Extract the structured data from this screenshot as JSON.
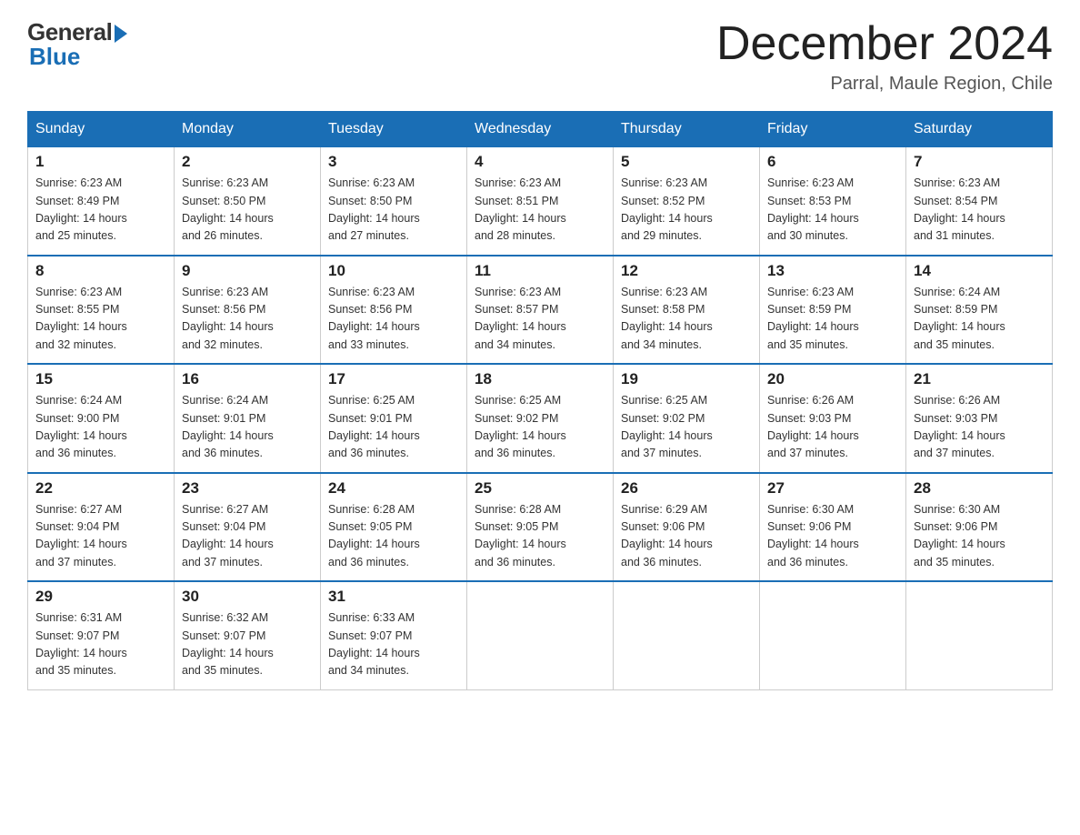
{
  "logo": {
    "general": "General",
    "blue": "Blue"
  },
  "title": "December 2024",
  "location": "Parral, Maule Region, Chile",
  "days_of_week": [
    "Sunday",
    "Monday",
    "Tuesday",
    "Wednesday",
    "Thursday",
    "Friday",
    "Saturday"
  ],
  "weeks": [
    [
      {
        "day": "1",
        "sunrise": "6:23 AM",
        "sunset": "8:49 PM",
        "daylight": "14 hours and 25 minutes."
      },
      {
        "day": "2",
        "sunrise": "6:23 AM",
        "sunset": "8:50 PM",
        "daylight": "14 hours and 26 minutes."
      },
      {
        "day": "3",
        "sunrise": "6:23 AM",
        "sunset": "8:50 PM",
        "daylight": "14 hours and 27 minutes."
      },
      {
        "day": "4",
        "sunrise": "6:23 AM",
        "sunset": "8:51 PM",
        "daylight": "14 hours and 28 minutes."
      },
      {
        "day": "5",
        "sunrise": "6:23 AM",
        "sunset": "8:52 PM",
        "daylight": "14 hours and 29 minutes."
      },
      {
        "day": "6",
        "sunrise": "6:23 AM",
        "sunset": "8:53 PM",
        "daylight": "14 hours and 30 minutes."
      },
      {
        "day": "7",
        "sunrise": "6:23 AM",
        "sunset": "8:54 PM",
        "daylight": "14 hours and 31 minutes."
      }
    ],
    [
      {
        "day": "8",
        "sunrise": "6:23 AM",
        "sunset": "8:55 PM",
        "daylight": "14 hours and 32 minutes."
      },
      {
        "day": "9",
        "sunrise": "6:23 AM",
        "sunset": "8:56 PM",
        "daylight": "14 hours and 32 minutes."
      },
      {
        "day": "10",
        "sunrise": "6:23 AM",
        "sunset": "8:56 PM",
        "daylight": "14 hours and 33 minutes."
      },
      {
        "day": "11",
        "sunrise": "6:23 AM",
        "sunset": "8:57 PM",
        "daylight": "14 hours and 34 minutes."
      },
      {
        "day": "12",
        "sunrise": "6:23 AM",
        "sunset": "8:58 PM",
        "daylight": "14 hours and 34 minutes."
      },
      {
        "day": "13",
        "sunrise": "6:23 AM",
        "sunset": "8:59 PM",
        "daylight": "14 hours and 35 minutes."
      },
      {
        "day": "14",
        "sunrise": "6:24 AM",
        "sunset": "8:59 PM",
        "daylight": "14 hours and 35 minutes."
      }
    ],
    [
      {
        "day": "15",
        "sunrise": "6:24 AM",
        "sunset": "9:00 PM",
        "daylight": "14 hours and 36 minutes."
      },
      {
        "day": "16",
        "sunrise": "6:24 AM",
        "sunset": "9:01 PM",
        "daylight": "14 hours and 36 minutes."
      },
      {
        "day": "17",
        "sunrise": "6:25 AM",
        "sunset": "9:01 PM",
        "daylight": "14 hours and 36 minutes."
      },
      {
        "day": "18",
        "sunrise": "6:25 AM",
        "sunset": "9:02 PM",
        "daylight": "14 hours and 36 minutes."
      },
      {
        "day": "19",
        "sunrise": "6:25 AM",
        "sunset": "9:02 PM",
        "daylight": "14 hours and 37 minutes."
      },
      {
        "day": "20",
        "sunrise": "6:26 AM",
        "sunset": "9:03 PM",
        "daylight": "14 hours and 37 minutes."
      },
      {
        "day": "21",
        "sunrise": "6:26 AM",
        "sunset": "9:03 PM",
        "daylight": "14 hours and 37 minutes."
      }
    ],
    [
      {
        "day": "22",
        "sunrise": "6:27 AM",
        "sunset": "9:04 PM",
        "daylight": "14 hours and 37 minutes."
      },
      {
        "day": "23",
        "sunrise": "6:27 AM",
        "sunset": "9:04 PM",
        "daylight": "14 hours and 37 minutes."
      },
      {
        "day": "24",
        "sunrise": "6:28 AM",
        "sunset": "9:05 PM",
        "daylight": "14 hours and 36 minutes."
      },
      {
        "day": "25",
        "sunrise": "6:28 AM",
        "sunset": "9:05 PM",
        "daylight": "14 hours and 36 minutes."
      },
      {
        "day": "26",
        "sunrise": "6:29 AM",
        "sunset": "9:06 PM",
        "daylight": "14 hours and 36 minutes."
      },
      {
        "day": "27",
        "sunrise": "6:30 AM",
        "sunset": "9:06 PM",
        "daylight": "14 hours and 36 minutes."
      },
      {
        "day": "28",
        "sunrise": "6:30 AM",
        "sunset": "9:06 PM",
        "daylight": "14 hours and 35 minutes."
      }
    ],
    [
      {
        "day": "29",
        "sunrise": "6:31 AM",
        "sunset": "9:07 PM",
        "daylight": "14 hours and 35 minutes."
      },
      {
        "day": "30",
        "sunrise": "6:32 AM",
        "sunset": "9:07 PM",
        "daylight": "14 hours and 35 minutes."
      },
      {
        "day": "31",
        "sunrise": "6:33 AM",
        "sunset": "9:07 PM",
        "daylight": "14 hours and 34 minutes."
      },
      null,
      null,
      null,
      null
    ]
  ],
  "labels": {
    "sunrise": "Sunrise:",
    "sunset": "Sunset:",
    "daylight": "Daylight:"
  }
}
